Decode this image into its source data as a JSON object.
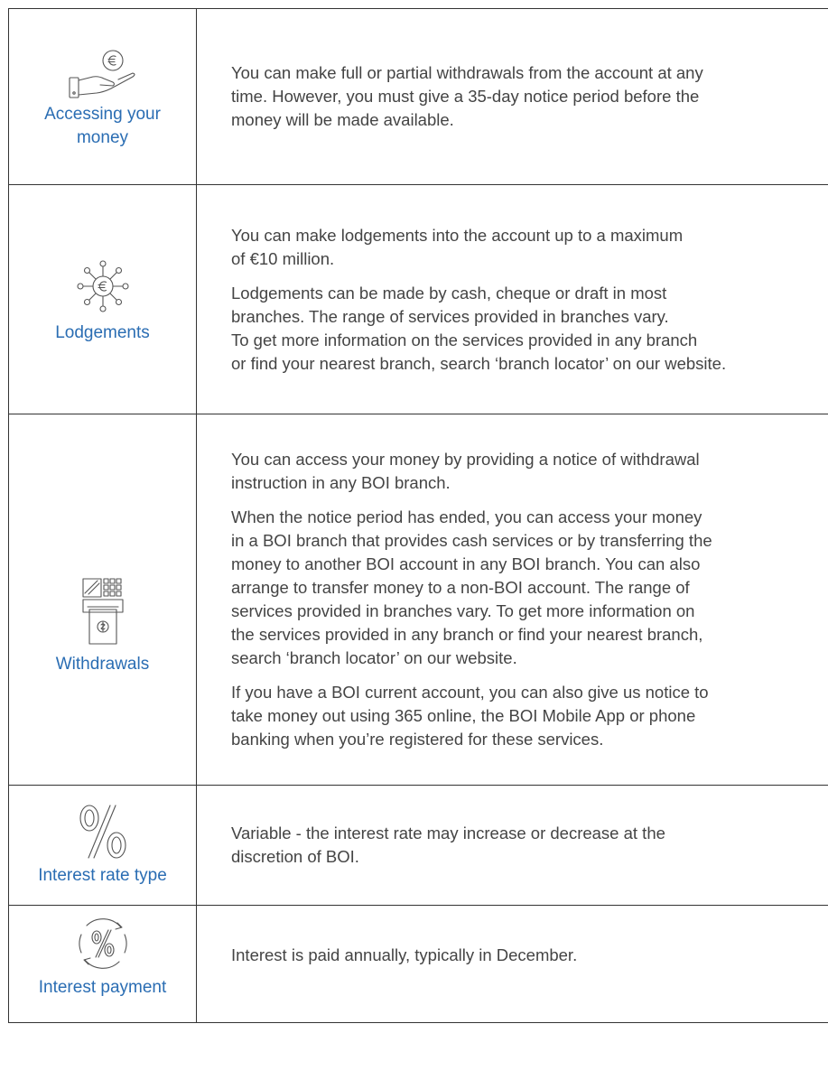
{
  "rows": [
    {
      "label": "Accessing your\nmoney",
      "icon": "hand-euro-icon",
      "paragraphs": [
        "You can make full or partial withdrawals from the account at any\ntime. However, you must give a 35-day notice period before the\nmoney will be made available."
      ]
    },
    {
      "label": "Lodgements",
      "icon": "euro-network-icon",
      "paragraphs": [
        "You can make lodgements into the account up to a maximum\nof €10 million.",
        "Lodgements can be made by cash, cheque or draft in most\nbranches. The range of services provided in branches vary.\nTo get more information on the services provided in any branch\nor find your nearest branch, search ‘branch locator’ on our website."
      ]
    },
    {
      "label": "Withdrawals",
      "icon": "atm-icon",
      "paragraphs": [
        "You can access your money by providing a notice of withdrawal\ninstruction in any BOI branch.",
        "When the notice period has ended, you can access your money\nin a BOI branch that provides cash services or by transferring the\nmoney to another BOI account in any BOI branch. You can also\narrange to transfer money to a non-BOI account. The range of\nservices provided in branches vary. To get more information on\nthe services provided in any branch or find your nearest branch,\nsearch ‘branch locator’ on our website.",
        "If you have a BOI current account, you can also give us notice to\ntake money out using 365 online, the BOI Mobile App or phone\nbanking when you’re registered for these services."
      ]
    },
    {
      "label": "Interest rate type",
      "icon": "percent-icon",
      "paragraphs": [
        "Variable - the interest rate may increase or decrease at the\ndiscretion of BOI."
      ]
    },
    {
      "label": "Interest payment",
      "icon": "percent-cycle-icon",
      "paragraphs": [
        "Interest is paid annually, typically in December."
      ]
    }
  ]
}
